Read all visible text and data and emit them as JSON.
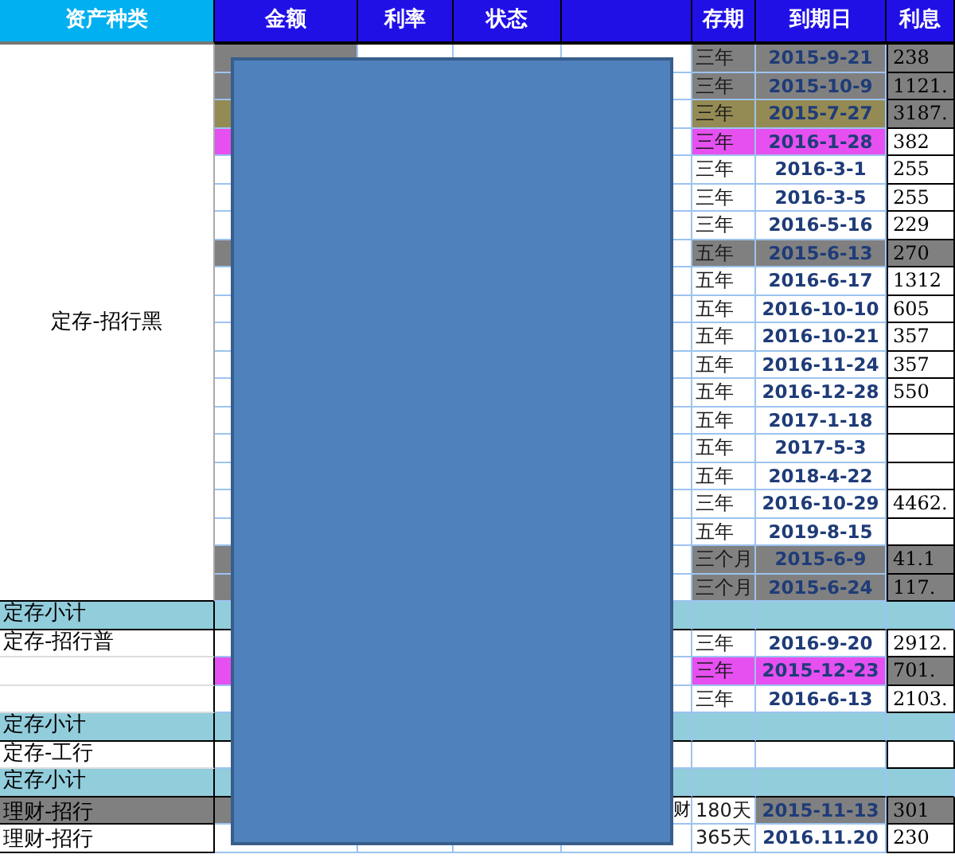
{
  "columns": [
    {
      "label": "资产种类",
      "kind": "category"
    },
    {
      "label": "金额",
      "kind": "main"
    },
    {
      "label": "利率",
      "kind": "main"
    },
    {
      "label": "状态",
      "kind": "main"
    },
    {
      "kind": "main"
    },
    {
      "label": "存期",
      "kind": "main"
    },
    {
      "label": "到期日",
      "kind": "main"
    },
    {
      "label": "利息",
      "kind": "main"
    }
  ],
  "sections": [
    {
      "kind": "group",
      "category": "定存-招行黑",
      "merged": true,
      "rows": [
        {
          "term": "三年",
          "due": "2015-9-21",
          "interest": "238",
          "color": "#808080",
          "interest_highlight": true
        },
        {
          "term": "三年",
          "due": "2015-10-9",
          "interest": "1121.",
          "color": "#808080",
          "interest_highlight": true
        },
        {
          "term": "三年",
          "due": "2015-7-27",
          "interest": "3187.",
          "color": "#948a54",
          "interest_highlight": true
        },
        {
          "term": "三年",
          "due": "2016-1-28",
          "interest": "382",
          "color": "#e650f0",
          "interest_highlight": false
        },
        {
          "term": "三年",
          "due": "2016-3-1",
          "interest": "255",
          "color": "#ffffff",
          "interest_highlight": false
        },
        {
          "term": "三年",
          "due": "2016-3-5",
          "interest": "255",
          "color": "#ffffff",
          "interest_highlight": false
        },
        {
          "term": "三年",
          "due": "2016-5-16",
          "interest": "229",
          "color": "#ffffff",
          "interest_highlight": false
        },
        {
          "term": "五年",
          "due": "2015-6-13",
          "interest": "270",
          "color": "#808080",
          "interest_highlight": true
        },
        {
          "term": "五年",
          "due": "2016-6-17",
          "interest": "1312",
          "color": "#ffffff",
          "interest_highlight": false
        },
        {
          "term": "五年",
          "due": "2016-10-10",
          "interest": "605",
          "color": "#ffffff",
          "interest_highlight": false
        },
        {
          "term": "五年",
          "due": "2016-10-21",
          "interest": "357",
          "color": "#ffffff",
          "interest_highlight": false
        },
        {
          "term": "五年",
          "due": "2016-11-24",
          "interest": "357",
          "color": "#ffffff",
          "interest_highlight": false
        },
        {
          "term": "五年",
          "due": "2016-12-28",
          "interest": "550",
          "color": "#ffffff",
          "interest_highlight": false
        },
        {
          "term": "五年",
          "due": "2017-1-18",
          "color": "#ffffff",
          "interest_highlight": false
        },
        {
          "term": "五年",
          "due": "2017-5-3",
          "color": "#ffffff",
          "interest_highlight": false
        },
        {
          "term": "五年",
          "due": "2018-4-22",
          "color": "#ffffff",
          "interest_highlight": false
        },
        {
          "term": "三年",
          "due": "2016-10-29",
          "interest": "4462.",
          "color": "#ffffff",
          "interest_highlight": false
        },
        {
          "term": "五年",
          "due": "2019-8-15",
          "color": "#ffffff",
          "interest_highlight": false
        },
        {
          "term": "三个月",
          "due": "2015-6-9",
          "interest": "41.1",
          "color": "#808080",
          "interest_highlight": true
        },
        {
          "term": "三个月",
          "due": "2015-6-24",
          "interest": "117.",
          "color": "#808080",
          "interest_highlight": true
        }
      ]
    },
    {
      "kind": "subtotal",
      "label": "定存小计"
    },
    {
      "kind": "group",
      "category": "定存-招行普",
      "merged": false,
      "rows": [
        {
          "term": "三年",
          "due": "2016-9-20",
          "interest": "2912.",
          "color": "#ffffff",
          "interest_highlight": false
        },
        {
          "term": "三年",
          "due": "2015-12-23",
          "interest": "701.",
          "color": "#e650f0",
          "interest_highlight": true
        },
        {
          "term": "三年",
          "due": "2016-6-13",
          "interest": "2103.",
          "color": "#ffffff",
          "interest_highlight": false
        }
      ]
    },
    {
      "kind": "subtotal",
      "label": "定存小计"
    },
    {
      "kind": "group",
      "category": "定存-工行",
      "merged": false,
      "rows": [
        {
          "color": "#ffffff",
          "interest_highlight": false
        }
      ]
    },
    {
      "kind": "subtotal",
      "label": "定存小计"
    },
    {
      "kind": "wealth",
      "category": "理财-招行",
      "rows": [
        {
          "col5": "财",
          "term": "180天",
          "due": "2015-11-13",
          "interest": "301",
          "color": "#808080",
          "interest_highlight": true
        }
      ]
    },
    {
      "kind": "wealth",
      "category": "理财-招行",
      "rows": [
        {
          "term": "365天",
          "due": "2016.11.20",
          "interest": "230",
          "color": "#ffffff",
          "interest_highlight": false
        }
      ]
    }
  ]
}
